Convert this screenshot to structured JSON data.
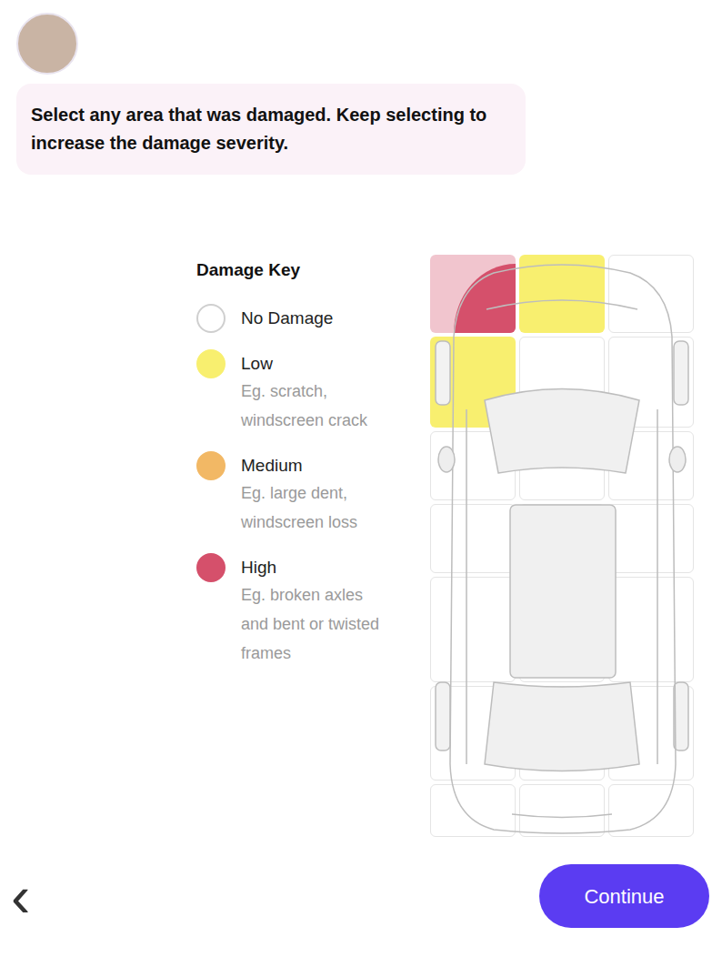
{
  "prompt": {
    "text": "Select any area that was damaged. Keep selecting to increase the damage severity."
  },
  "damage_key": {
    "title": "Damage Key",
    "items": [
      {
        "level": "none",
        "label": "No Damage",
        "example_lines": [],
        "color": "#ffffff"
      },
      {
        "level": "low",
        "label": "Low",
        "example_lines": [
          "Eg. scratch,",
          "windscreen crack"
        ],
        "color": "#f8ef6f"
      },
      {
        "level": "medium",
        "label": "Medium",
        "example_lines": [
          "Eg. large dent,",
          "windscreen loss"
        ],
        "color": "#f2b865"
      },
      {
        "level": "high",
        "label": "High",
        "example_lines": [
          "Eg. broken axles",
          "and bent or twisted",
          "frames"
        ],
        "color": "#d5506b"
      }
    ]
  },
  "car_grid": {
    "rows": [
      [
        "high",
        "low",
        "none"
      ],
      [
        "low",
        "none",
        "none"
      ],
      [
        "none",
        "none",
        "none"
      ],
      [
        "none",
        "none",
        "none"
      ],
      [
        "none",
        "none",
        "none"
      ],
      [
        "none",
        "none",
        "none"
      ],
      [
        "none",
        "none",
        "none"
      ]
    ]
  },
  "buttons": {
    "back": "‹",
    "continue": "Continue"
  }
}
